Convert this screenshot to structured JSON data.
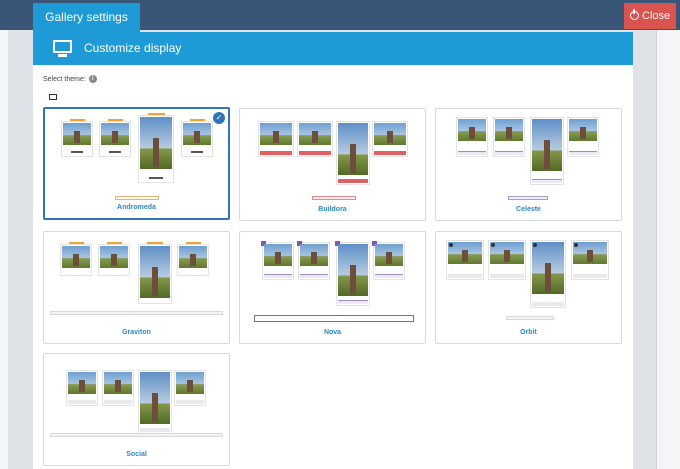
{
  "header": {
    "tab_label": "Gallery settings",
    "close_label": "Close"
  },
  "panel": {
    "title": "Customize display",
    "select_theme_label": "Select theme:"
  },
  "themes": [
    {
      "name": "Andromeda",
      "selected": true
    },
    {
      "name": "Buildora",
      "selected": false
    },
    {
      "name": "Celeste",
      "selected": false
    },
    {
      "name": "Graviton",
      "selected": false
    },
    {
      "name": "Nova",
      "selected": false
    },
    {
      "name": "Orbit",
      "selected": false
    },
    {
      "name": "Social",
      "selected": false
    }
  ],
  "colors": {
    "accent": "#1e9bd7",
    "topbar": "#3a5676",
    "close": "#d9534f",
    "selected_border": "#2f75b8",
    "theme_name": "#2b88c6"
  }
}
